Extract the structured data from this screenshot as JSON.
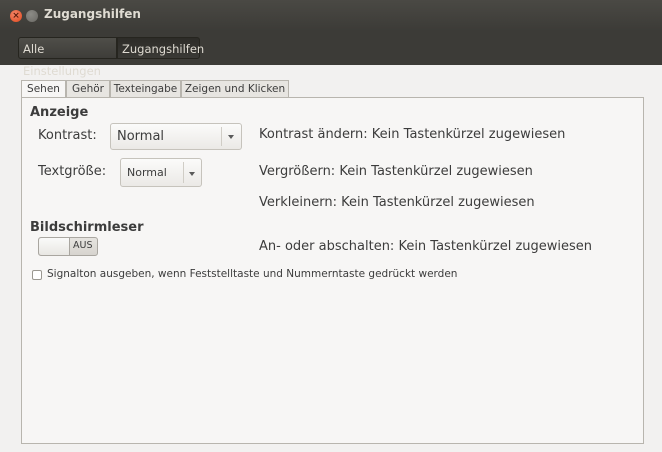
{
  "window": {
    "title": "Zugangshilfen",
    "close_icon": "close-icon",
    "minimize_icon": "minimize-icon"
  },
  "toolbar": {
    "all_settings": "Alle Einstellungen",
    "current": "Zugangshilfen"
  },
  "tabs": [
    {
      "label": "Sehen",
      "active": true
    },
    {
      "label": "Gehör",
      "active": false
    },
    {
      "label": "Texteingabe",
      "active": false
    },
    {
      "label": "Zeigen und Klicken",
      "active": false
    }
  ],
  "display": {
    "section_title": "Anzeige",
    "contrast_label": "Kontrast:",
    "contrast_value": "Normal",
    "textsize_label": "Textgröße:",
    "textsize_value": "Normal",
    "shortcut_contrast": "Kontrast ändern: Kein Tastenkürzel zugewiesen",
    "shortcut_zoom_in": "Vergrößern: Kein Tastenkürzel zugewiesen",
    "shortcut_zoom_out": "Verkleinern: Kein Tastenkürzel zugewiesen"
  },
  "screenreader": {
    "section_title": "Bildschirmleser",
    "switch_state": "AUS",
    "shortcut_toggle": "An- oder abschalten: Kein Tastenkürzel zugewiesen"
  },
  "beep": {
    "label": "Signalton ausgeben, wenn Feststelltaste und Nummerntaste gedrückt werden",
    "checked": false
  },
  "colors": {
    "titlebar": "#3c3b37",
    "close_button": "#e0481c",
    "background": "#f2f1f0"
  }
}
